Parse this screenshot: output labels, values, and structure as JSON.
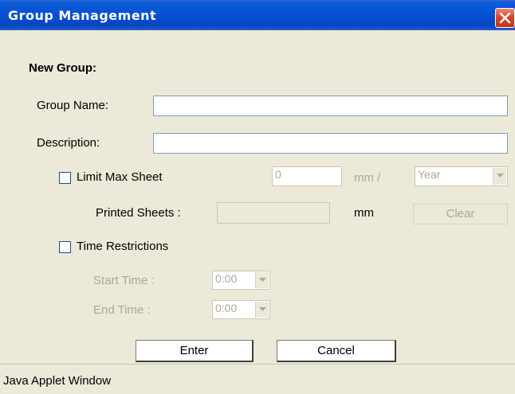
{
  "window": {
    "title": "Group Management"
  },
  "section": {
    "heading": "New Group:"
  },
  "form": {
    "group_name_label": "Group Name:",
    "group_name_value": "",
    "description_label": "Description:",
    "description_value": "",
    "limit_max_sheet_label": "Limit Max Sheet",
    "limit_max_sheet_checked": false,
    "limit_value": "0",
    "limit_unit": "mm /",
    "period_selected": "Year",
    "printed_sheets_label": "Printed Sheets :",
    "printed_sheets_value": "",
    "printed_sheets_unit": "mm",
    "clear_label": "Clear",
    "time_restrictions_label": "Time Restrictions",
    "time_restrictions_checked": false,
    "start_time_label": "Start Time :",
    "start_time_value": "0:00",
    "end_time_label": "End Time :",
    "end_time_value": "0:00"
  },
  "buttons": {
    "enter_label": "Enter",
    "cancel_label": "Cancel"
  },
  "status": {
    "text": "Java Applet Window"
  },
  "colors": {
    "titlebar": "#0753d4",
    "panel": "#ece9d8",
    "close": "#d9472b",
    "disabled_text": "#aca899"
  }
}
